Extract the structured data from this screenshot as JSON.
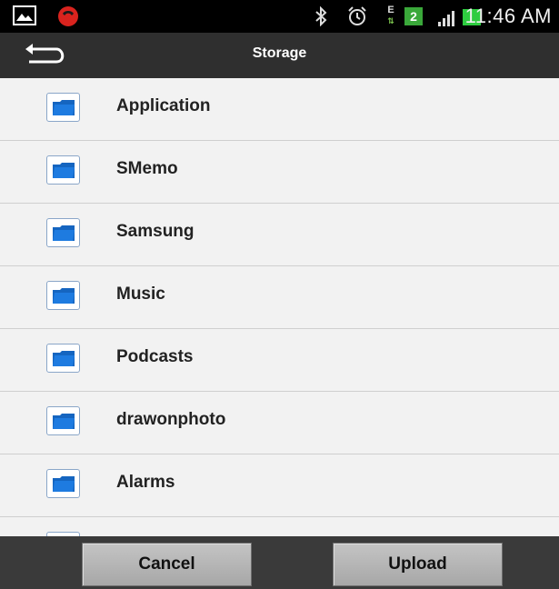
{
  "status_bar": {
    "time": "11:46 AM",
    "sim_badge": "2",
    "data_badge": "E",
    "icons": [
      "image-icon",
      "call-icon",
      "bluetooth-icon",
      "alarm-icon",
      "data-e-icon",
      "sim-2-icon",
      "signal-icon",
      "battery-icon"
    ]
  },
  "action_bar": {
    "title": "Storage",
    "back_icon": "back-arrow-icon"
  },
  "folders": [
    {
      "label": "Application",
      "icon": "folder-icon"
    },
    {
      "label": "SMemo",
      "icon": "folder-icon"
    },
    {
      "label": "Samsung",
      "icon": "folder-icon"
    },
    {
      "label": "Music",
      "icon": "folder-icon"
    },
    {
      "label": "Podcasts",
      "icon": "folder-icon"
    },
    {
      "label": "drawonphoto",
      "icon": "folder-icon"
    },
    {
      "label": "Alarms",
      "icon": "folder-icon"
    },
    {
      "label": "",
      "icon": "folder-icon"
    }
  ],
  "buttons": {
    "cancel": "Cancel",
    "upload": "Upload"
  },
  "colors": {
    "status_bar": "#000000",
    "action_bar": "#2f2f2f",
    "list_bg": "#f2f2f2",
    "folder_blue": "#1565c0",
    "battery_green": "#2ecc40"
  }
}
